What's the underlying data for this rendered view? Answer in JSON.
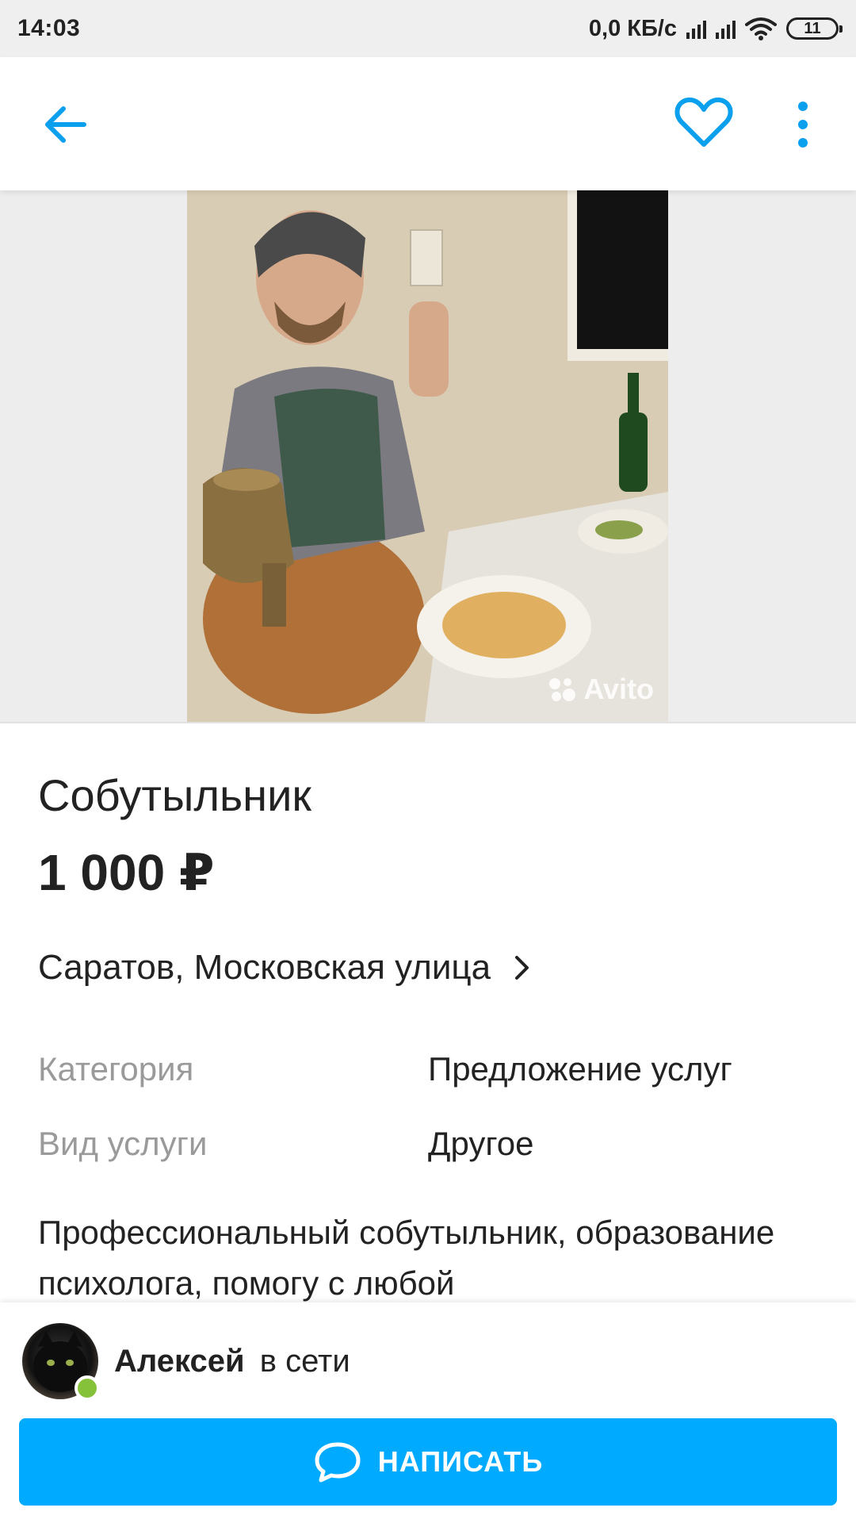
{
  "status_bar": {
    "time": "14:03",
    "network_speed": "0,0 КБ/с",
    "battery": "11"
  },
  "toolbar": {
    "back_icon": "arrow-left-icon",
    "favorite_icon": "heart-outline-icon",
    "more_icon": "more-vertical-icon",
    "accent_color": "#0aa0ee"
  },
  "gallery": {
    "watermark": "Avito"
  },
  "listing": {
    "title": "Собутыльник",
    "price": "1 000 ₽",
    "address": "Саратов, Московская улица",
    "params": [
      {
        "label": "Категория",
        "value": "Предложение услуг"
      },
      {
        "label": "Вид услуги",
        "value": "Другое"
      }
    ],
    "description": "Профессиональный собутыльник, образование психолога, помогу с любой"
  },
  "seller": {
    "name": "Алексей",
    "status": "в сети",
    "online_color": "#86c13a"
  },
  "actions": {
    "write_label": "НАПИСАТЬ",
    "write_icon": "chat-bubble-icon",
    "button_color": "#00aaff"
  }
}
